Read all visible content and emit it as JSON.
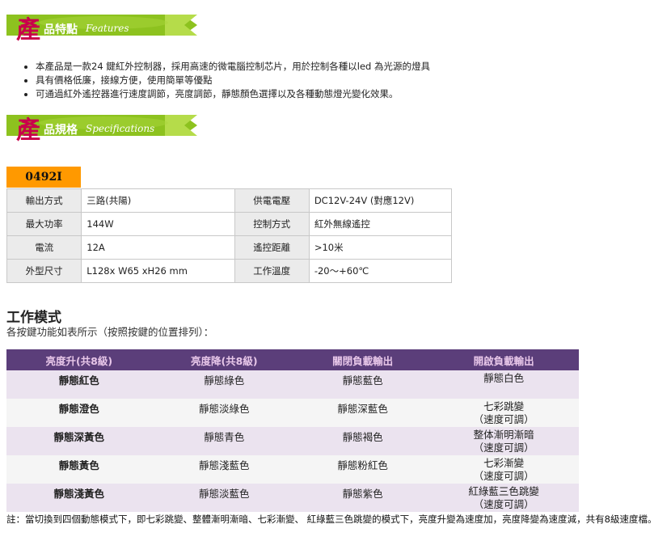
{
  "banners": {
    "features": {
      "big": "產",
      "small": "品特點",
      "en": "Features"
    },
    "specs": {
      "big": "產",
      "small": "品規格",
      "en": "Specifications"
    }
  },
  "features": [
    "本產品是一款24 鍵紅外控制器，採用高速的微電腦控制芯片，用於控制各種以led 為光源的燈具",
    "具有價格低廉，接線方便，使用簡單等優點",
    "可通過紅外遙控器進行速度調節，亮度調節，靜態顏色選擇以及各種動態燈光變化效果。"
  ],
  "model": "0492I",
  "specs": [
    {
      "k1": "輸出方式",
      "v1": "三路(共陽)",
      "k2": "供電電壓",
      "v2": "DC12V-24V (對應12V)"
    },
    {
      "k1": "最大功率",
      "v1": "144W",
      "k2": "控制方式",
      "v2": "紅外無線遙控"
    },
    {
      "k1": "電流",
      "v1": "12A",
      "k2": "遙控距離",
      "v2": ">10米"
    },
    {
      "k1": "外型尺寸",
      "v1": "L128x W65 xH26 mm",
      "k2": "工作溫度",
      "v2": "-20～+60℃"
    }
  ],
  "mode": {
    "title": "工作模式",
    "subtitle": "各按鍵功能如表所示（按照按鍵的位置排列）："
  },
  "keys_table": {
    "headers": [
      "亮度升(共8級)",
      "亮度降(共8級)",
      "關閉負載輸出",
      "開啟負載輸出"
    ],
    "rows": [
      [
        "靜態紅色",
        "靜態綠色",
        "靜態藍色",
        "靜態白色",
        ""
      ],
      [
        "靜態澄色",
        "靜態淡綠色",
        "靜態深藍色",
        "七彩跳變",
        "（速度可調）"
      ],
      [
        "靜態深黃色",
        "靜態青色",
        "靜態褐色",
        "整体漸明漸暗",
        "（速度可調）"
      ],
      [
        "靜態黃色",
        "靜態淺藍色",
        "靜態粉紅色",
        "七彩漸變",
        "（速度可調）"
      ],
      [
        "靜態淺黃色",
        "靜態淡藍色",
        "靜態紫色",
        "紅綠藍三色跳變",
        "（速度可調）"
      ]
    ]
  },
  "note": "註：當切換到四個動態模式下，即七彩跳變、整體漸明漸暗、七彩漸變、 紅綠藍三色跳變的模式下，亮度升變為速度加，亮度降變為速度減，共有8級速度檔。",
  "colors": {
    "banner_green": "#8dc21f",
    "magenta": "#c9004b",
    "orange": "#ff9900",
    "purple": "#5b3e7a"
  }
}
